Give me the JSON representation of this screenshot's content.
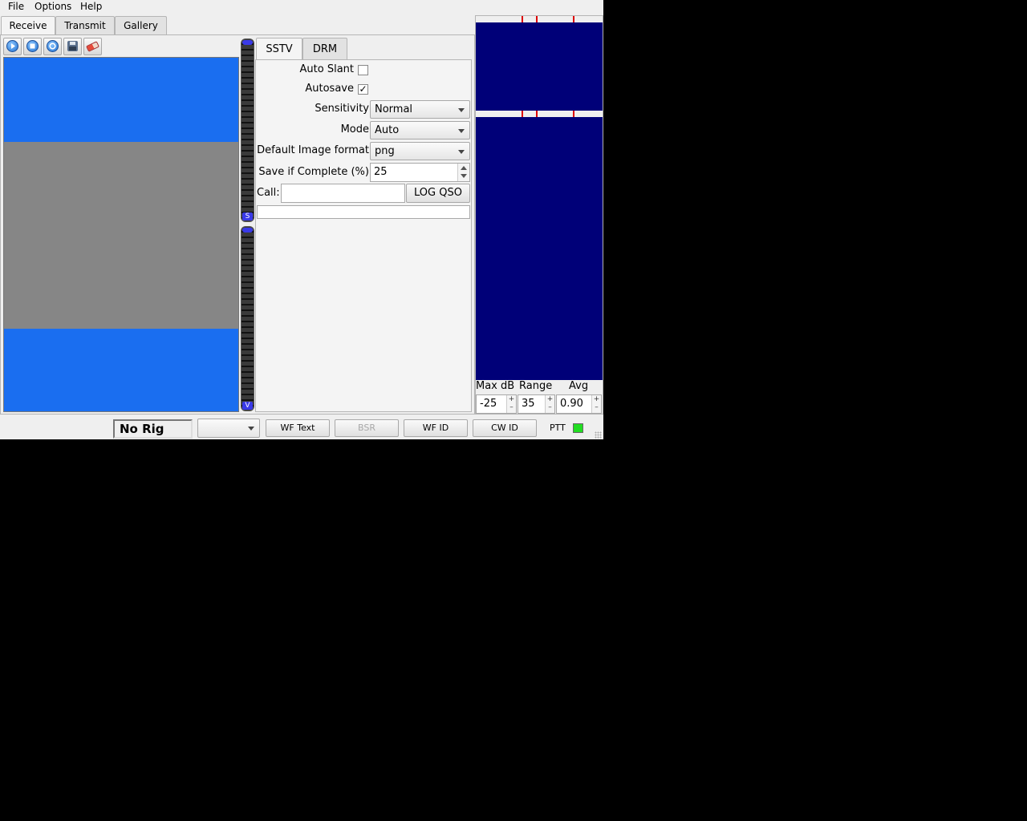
{
  "menu": [
    "File",
    "Options",
    "Help"
  ],
  "tabs": [
    "Receive",
    "Transmit",
    "Gallery"
  ],
  "toolbar_icons": [
    "start-icon",
    "stop-icon",
    "refresh-icon",
    "save-icon",
    "erase-icon"
  ],
  "meters": {
    "upper_label": "S",
    "lower_label": "V"
  },
  "subtabs": [
    "SSTV",
    "DRM"
  ],
  "sstv": {
    "auto_slant_label": "Auto Slant",
    "auto_slant_checked": false,
    "autosave_label": "Autosave",
    "autosave_checked": true,
    "autosave_mark": "✓",
    "sensitivity_label": "Sensitivity",
    "sensitivity_value": "Normal",
    "mode_label": "Mode",
    "mode_value": "Auto",
    "image_format_label": "Default Image format",
    "image_format_value": "png",
    "save_complete_label": "Save if Complete (%)",
    "save_complete_value": "25",
    "call_label": "Call:",
    "call_value": "",
    "log_qso_label": "LOG QSO"
  },
  "waterfall": {
    "max_db_label": "Max dB",
    "max_db_value": "-25",
    "range_label": "Range",
    "range_value": "35",
    "avg_label": "Avg",
    "avg_value": "0.90",
    "spin_plus": "+",
    "spin_minus": "–"
  },
  "statusbar": {
    "rig": "No Rig",
    "combo_value": "",
    "wf_text": "WF Text",
    "bsr": "BSR",
    "wf_id": "WF ID",
    "cw_id": "CW ID",
    "ptt_label": "PTT"
  },
  "colors": {
    "rx_image_blue": "#1a6ef0",
    "rx_image_gray": "#868686",
    "waterfall_bg": "#000078",
    "marker_red": "#dd0000",
    "ptt_led": "#22dd22"
  }
}
